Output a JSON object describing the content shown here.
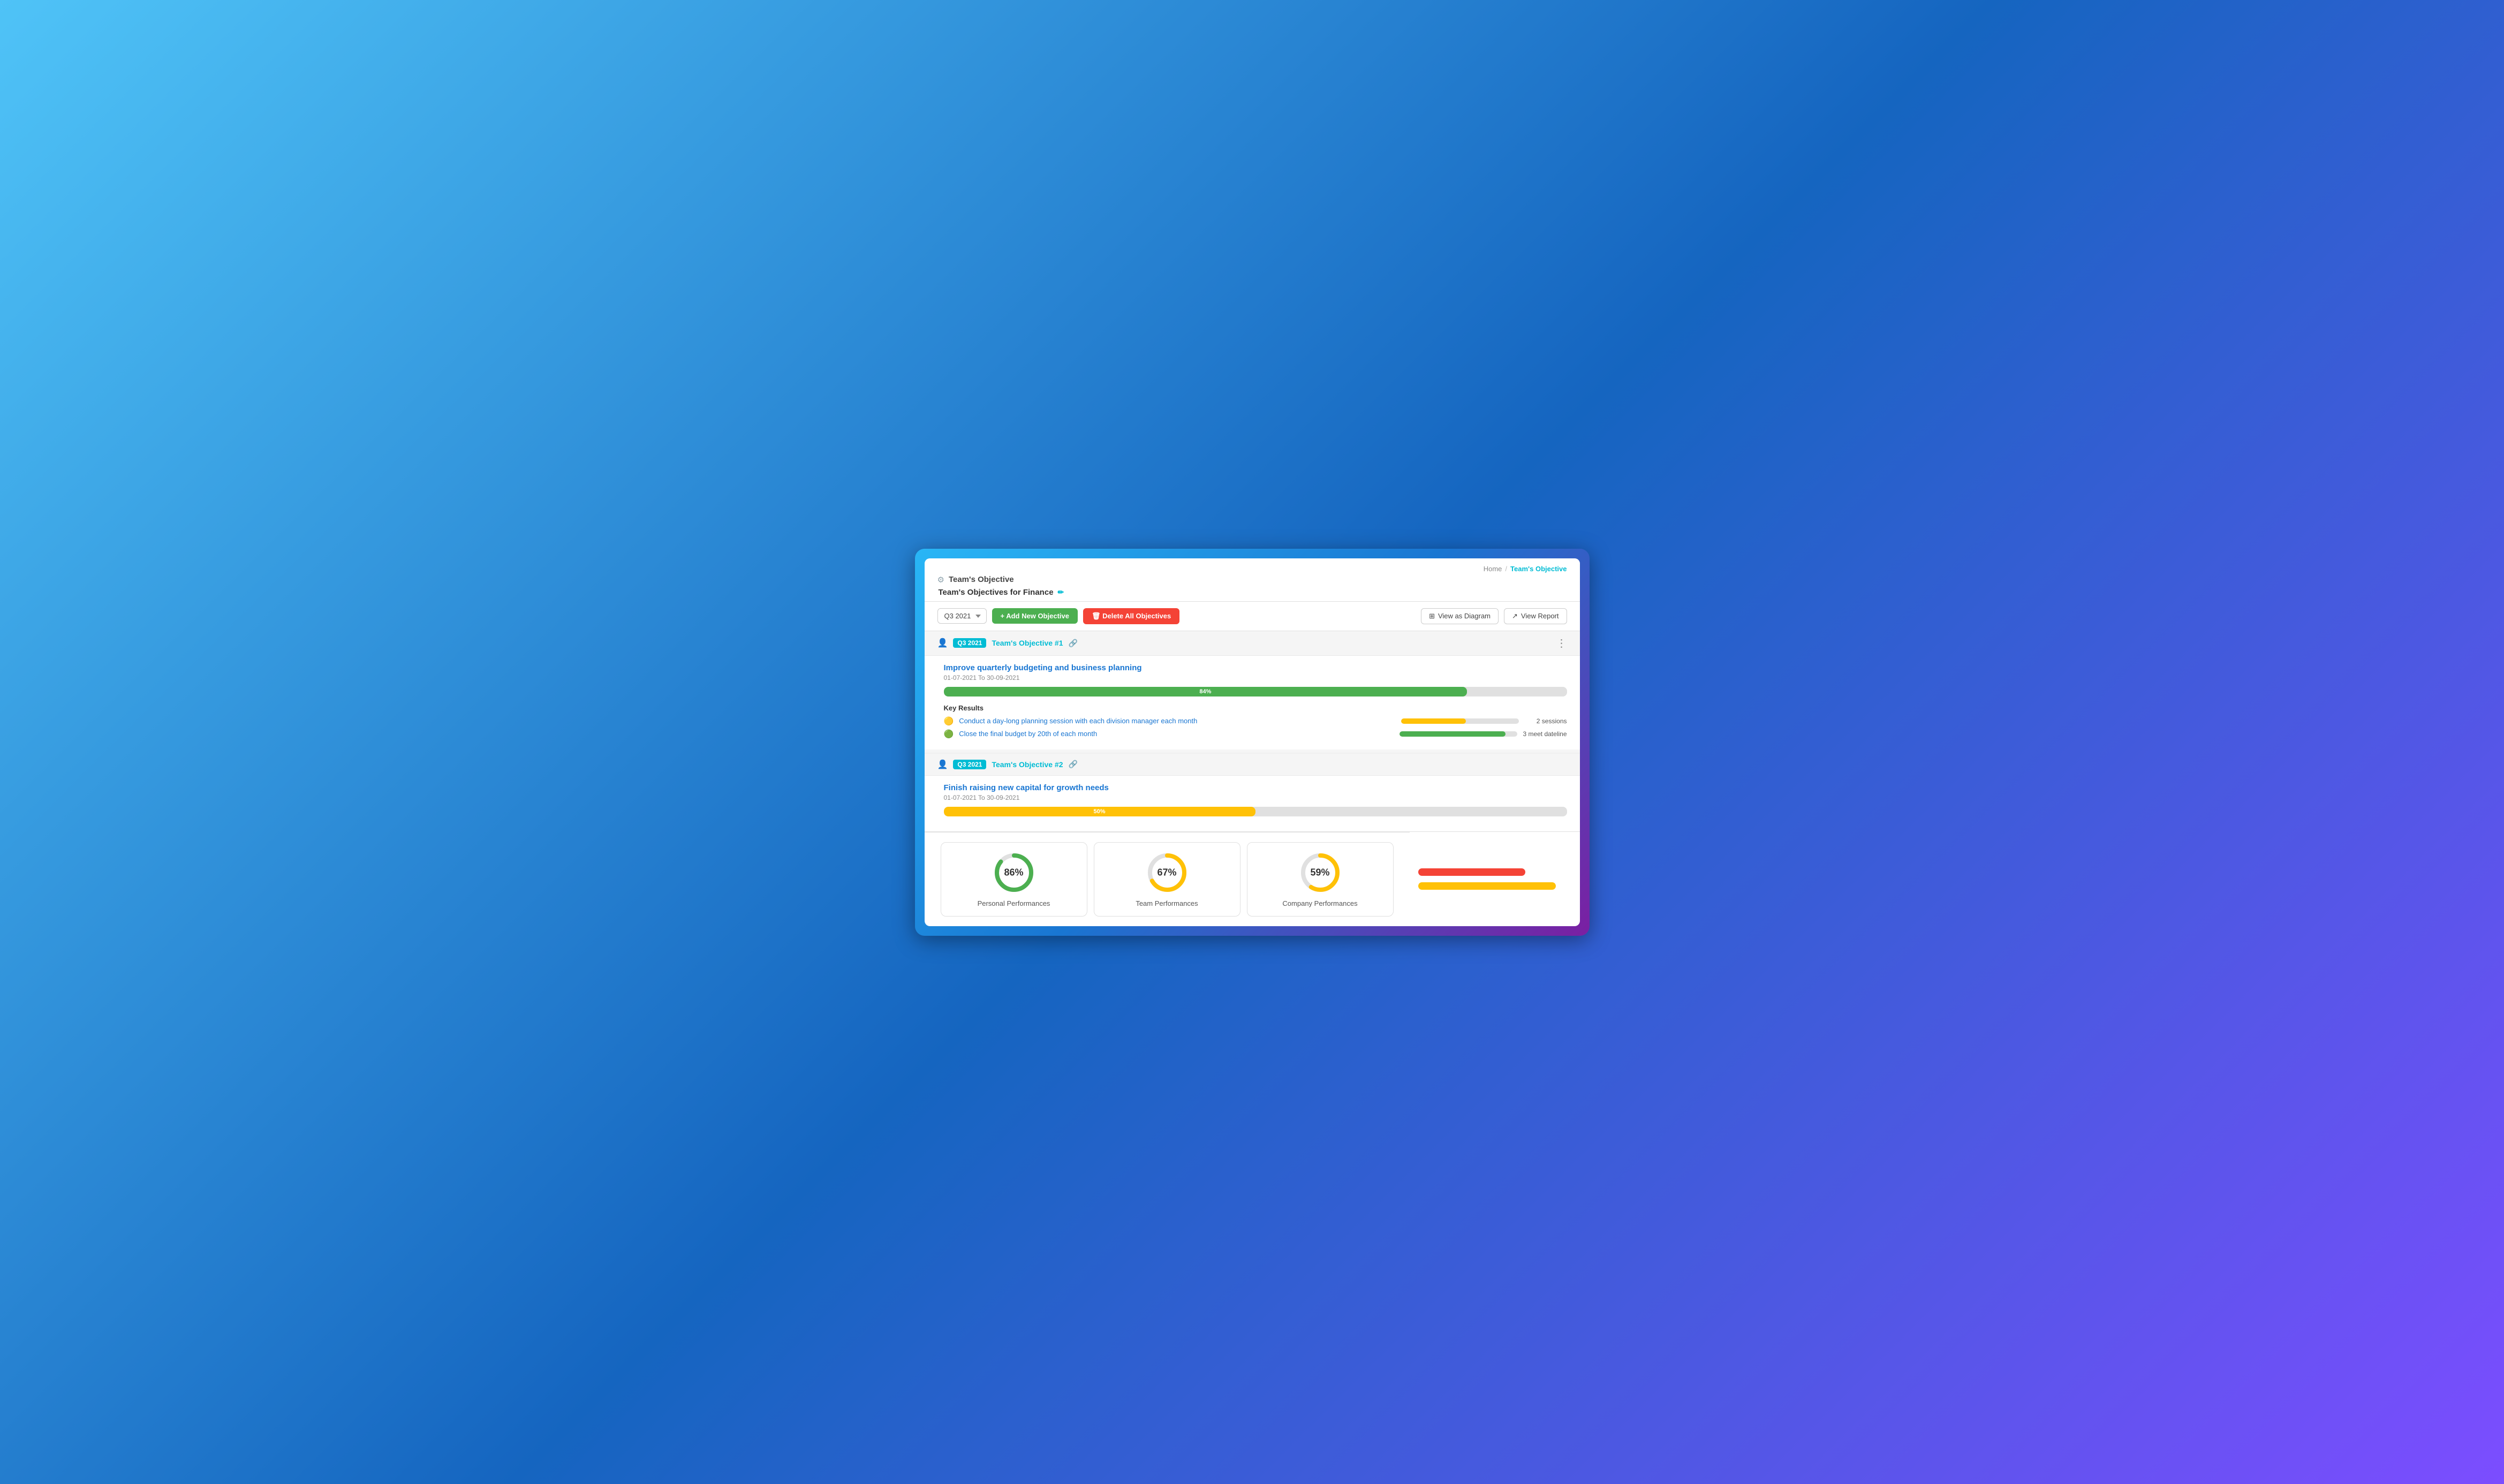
{
  "breadcrumb": {
    "home": "Home",
    "separator": "/",
    "current": "Team's Objective"
  },
  "header": {
    "page_icon": "⚙",
    "window_title": "Team's Objective",
    "page_title": "Team's Objectives for Finance",
    "edit_icon": "✏"
  },
  "toolbar": {
    "quarter_value": "Q3 2021",
    "add_label": "+ Add New Objective",
    "delete_label": "🗑 Delete All Objectives",
    "view_diagram_label": "View as Diagram",
    "view_report_label": "View Report",
    "diagram_icon": "⊞",
    "report_icon": "↗"
  },
  "objectives": [
    {
      "id": 1,
      "tag": "Q3 2021",
      "title": "Team's Objective #1",
      "name": "Improve quarterly budgeting and business planning",
      "dates": "01-07-2021 To 30-09-2021",
      "progress": 84,
      "progress_color": "green",
      "key_results_label": "Key Results",
      "key_results": [
        {
          "emoji": "🟡",
          "text": "Conduct a day-long planning session with each division manager each month",
          "bar_pct": 55,
          "bar_color": "yellow",
          "value": "2 sessions"
        },
        {
          "emoji": "🟢",
          "text": "Close the final budget by 20th of each month",
          "bar_pct": 90,
          "bar_color": "green",
          "value": "3 meet dateline"
        }
      ]
    },
    {
      "id": 2,
      "tag": "Q3 2021",
      "title": "Team's Objective #2",
      "name": "Finish raising new capital for growth needs",
      "dates": "01-07-2021 To 30-09-2021",
      "progress": 50,
      "progress_color": "yellow",
      "key_results": []
    }
  ],
  "performances": [
    {
      "label": "Personal Performances",
      "pct": 86,
      "color": "#4caf50",
      "track_color": "#e0e0e0"
    },
    {
      "label": "Team Performances",
      "pct": 67,
      "color": "#ffc107",
      "track_color": "#e0e0e0"
    },
    {
      "label": "Company Performances",
      "pct": 59,
      "color": "#ffc107",
      "track_color": "#e0e0e0"
    }
  ],
  "side_bars": [
    {
      "width": "70%",
      "color": "#f44336"
    },
    {
      "width": "90%",
      "color": "#ffc107"
    }
  ]
}
